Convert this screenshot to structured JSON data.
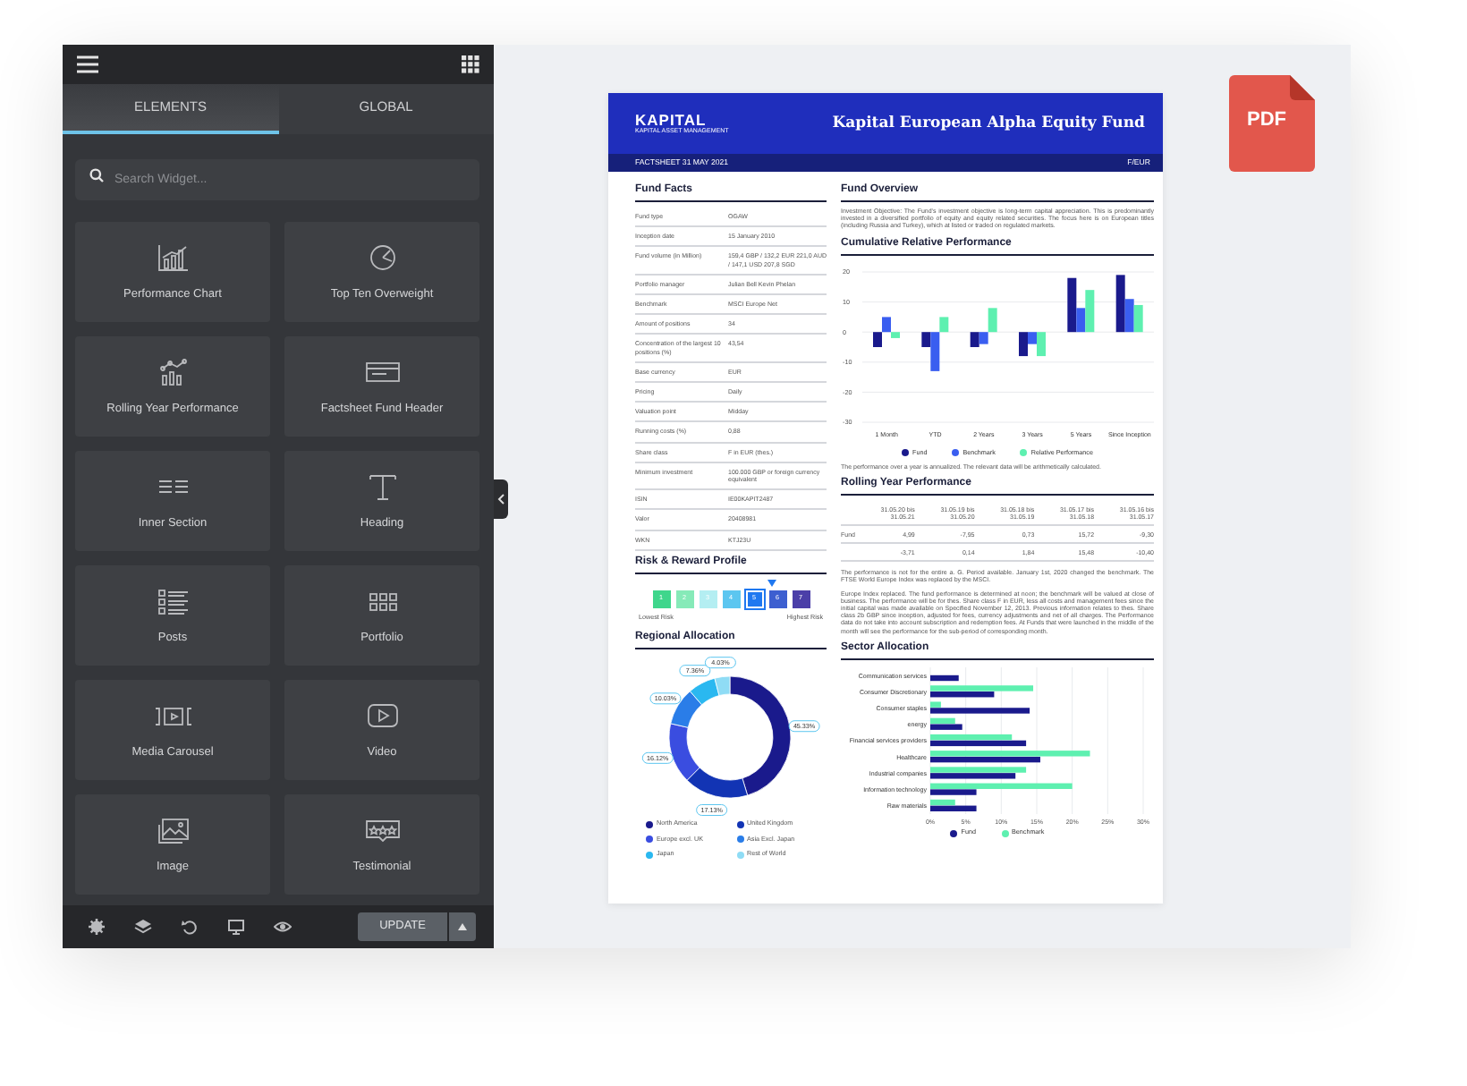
{
  "editor": {
    "tabs": [
      {
        "label": "ELEMENTS",
        "selected": true
      },
      {
        "label": "GLOBAL",
        "selected": false
      }
    ],
    "search": {
      "placeholder": "Search Widget..."
    },
    "widgets": [
      {
        "label": "Performance Chart",
        "kind": "chart"
      },
      {
        "label": "Top Ten Overweight",
        "kind": "pie"
      },
      {
        "label": "Rolling Year Performance",
        "kind": "trend"
      },
      {
        "label": "Factsheet Fund Header",
        "kind": "header"
      },
      {
        "label": "Inner Section",
        "kind": "columns"
      },
      {
        "label": "Heading",
        "kind": "heading"
      },
      {
        "label": "Posts",
        "kind": "posts"
      },
      {
        "label": "Portfolio",
        "kind": "grid"
      },
      {
        "label": "Media Carousel",
        "kind": "carousel"
      },
      {
        "label": "Video",
        "kind": "video"
      },
      {
        "label": "Image",
        "kind": "image"
      },
      {
        "label": "Testimonial",
        "kind": "testimonial"
      }
    ],
    "update_button": "UPDATE"
  },
  "pdf_badge": "PDF",
  "document": {
    "brand": "KAPITAL",
    "brand_tagline": "KAPITAL ASSET MANAGEMENT",
    "title": "Kapital European Alpha Equity Fund",
    "date_line": "FACTSHEET 31 MAY 2021",
    "share_class": "F/EUR",
    "fund_facts": {
      "heading": "Fund Facts",
      "rows": [
        {
          "label": "Fund type",
          "value": "OGAW"
        },
        {
          "label": "Inception date",
          "value": "15 January 2010"
        },
        {
          "label": "Fund volume (in Million)",
          "value": "159,4 GBP / 132,2 EUR 221,0 AUD / 147,1 USD 207,8 SGD"
        },
        {
          "label": "Portfolio manager",
          "value": "Julian Bell Kevin Phelan"
        },
        {
          "label": "Benchmark",
          "value": "MSCI Europe Net"
        },
        {
          "label": "Amount of positions",
          "value": "34"
        },
        {
          "label": "Concentration of the largest 10 positions (%)",
          "value": "43,54"
        },
        {
          "label": "Base currency",
          "value": "EUR"
        },
        {
          "label": "Pricing",
          "value": "Daily"
        },
        {
          "label": "Valuation point",
          "value": "Midday"
        },
        {
          "label": "Running costs (%)",
          "value": "0,88"
        },
        {
          "label": "Share class",
          "value": "F in EUR (thes.)"
        },
        {
          "label": "Minimum investment",
          "value": "100.000 GBP or foreign currency equivalent"
        },
        {
          "label": "ISIN",
          "value": "IE00KAPIT2487"
        },
        {
          "label": "Valor",
          "value": "20408981"
        },
        {
          "label": "WKN",
          "value": "KTJ23U"
        }
      ]
    },
    "risk_profile": {
      "heading": "Risk & Reward Profile",
      "levels": [
        {
          "label": "1",
          "color": "#3fd68c",
          "selected": false
        },
        {
          "label": "2",
          "color": "#86eab8",
          "selected": false
        },
        {
          "label": "3",
          "color": "#b4eef2",
          "selected": false
        },
        {
          "label": "4",
          "color": "#5cc6f0",
          "selected": false
        },
        {
          "label": "5",
          "color": "#1f78f0",
          "selected": true
        },
        {
          "label": "6",
          "color": "#3d5fd0",
          "selected": false
        },
        {
          "label": "7",
          "color": "#4b3fa8",
          "selected": false
        }
      ],
      "low_label": "Lowest Risk",
      "high_label": "Highest Risk"
    },
    "regional_allocation": {
      "heading": "Regional Allocation",
      "chart_data": {
        "type": "donut",
        "categories": [
          "North America",
          "United Kingdom",
          "Europe excl. UK",
          "Asia Excl. Japan",
          "Japan",
          "Rest of World"
        ],
        "values": [
          45.33,
          17.13,
          16.12,
          10.03,
          7.36,
          4.03
        ],
        "colors": [
          "#1a1a8c",
          "#1234b4",
          "#3a4de0",
          "#2a7de8",
          "#2ab8f0",
          "#8fdcf5"
        ],
        "value_labels": [
          "45.33%",
          "17.13%",
          "16.12%",
          "10.03%",
          "7.36%",
          "4.03%"
        ],
        "legend": "bottom"
      }
    },
    "fund_overview": {
      "heading": "Fund Overview",
      "text": "Investment Objective: The Fund's investment objective is long-term capital appreciation. This is predominantly invested in a diversified portfolio of equity and equity related securities. The focus here is on European titles (including Russia and Turkey), which at listed or traded on regulated markets."
    },
    "cumulative_performance": {
      "heading": "Cumulative Relative Performance",
      "chart_data": {
        "type": "bar",
        "categories": [
          "1 Month",
          "YTD",
          "2 Years",
          "3 Years",
          "5 Years",
          "Since Inception"
        ],
        "series": [
          {
            "name": "Fund",
            "color": "#1a1a8c",
            "values": [
              -5,
              -5,
              -5,
              -8,
              18,
              19
            ]
          },
          {
            "name": "Benchmark",
            "color": "#3a5ef0",
            "values": [
              5,
              -13,
              -4,
              -4,
              8,
              11
            ]
          },
          {
            "name": "Relative Performance",
            "color": "#5ef0b0",
            "values": [
              -2,
              5,
              8,
              -8,
              14,
              9
            ]
          }
        ],
        "ylim": [
          -30,
          20
        ],
        "yticks": [
          -30,
          -20,
          -10,
          0,
          10,
          20
        ],
        "grid": true,
        "legend": "bottom"
      },
      "note": "The performance over a year is annualized. The relevant data will be arithmetically calculated."
    },
    "rolling_performance": {
      "heading": "Rolling Year Performance",
      "columns": [
        "31.05.20 bis 31.05.21",
        "31.05.19 bis 31.05.20",
        "31.05.18 bis 31.05.19",
        "31.05.17 bis 31.05.18",
        "31.05.16 bis 31.05.17"
      ],
      "rows": [
        {
          "label": "Fund",
          "values": [
            "4,99",
            "-7,95",
            "0,73",
            "15,72",
            "-9,30"
          ]
        },
        {
          "values": [
            "-3,71",
            "0,14",
            "1,84",
            "15,48",
            "-10,40"
          ]
        }
      ],
      "notes": [
        "The performance is not for the entire a. G. Period available. January 1st, 2020 changed the benchmark. The FTSE World Europe Index was replaced by the MSCI.",
        "Europe Index replaced. The fund performance is determined at noon; the benchmark will be valued at close of business. The performance will be for thes. Share class F in EUR, less all costs and management fees since the initial capital was made available on Specified November 12, 2013. Previous information relates to thes. Share class 2b GBP since inception, adjusted for fees, currency adjustments and net of all charges. The Performance data do not take into account subscription and redemption fees. At Funds that were launched in the middle of the month will see the performance for the sub-period of corresponding month."
      ]
    },
    "sector_allocation": {
      "heading": "Sector Allocation",
      "chart_data": {
        "type": "bar",
        "orientation": "horizontal",
        "categories": [
          "Communication services",
          "Consumer Discretionary",
          "Consumer staples",
          "energy",
          "Financial services providers",
          "Healthcare",
          "Industrial companies",
          "Information technology",
          "Raw materials"
        ],
        "series": [
          {
            "name": "Fund",
            "color": "#1a1a8c",
            "values": [
              4,
              9,
              14,
              4.5,
              13.5,
              15.5,
              12,
              6.5,
              6.5
            ]
          },
          {
            "name": "Benchmark",
            "color": "#5ef0b0",
            "values": [
              0,
              14.5,
              1.5,
              3.5,
              11.5,
              22.5,
              13.5,
              20,
              3.5
            ]
          }
        ],
        "xlim": [
          0,
          30
        ],
        "xticks": [
          {
            "value": 0,
            "label": "0%"
          },
          {
            "value": 5,
            "label": "5%"
          },
          {
            "value": 10,
            "label": "10%"
          },
          {
            "value": 15,
            "label": "15%"
          },
          {
            "value": 20,
            "label": "20%"
          },
          {
            "value": 25,
            "label": "25%"
          },
          {
            "value": 30,
            "label": "30%"
          }
        ],
        "grid": true,
        "legend": "bottom"
      }
    }
  }
}
